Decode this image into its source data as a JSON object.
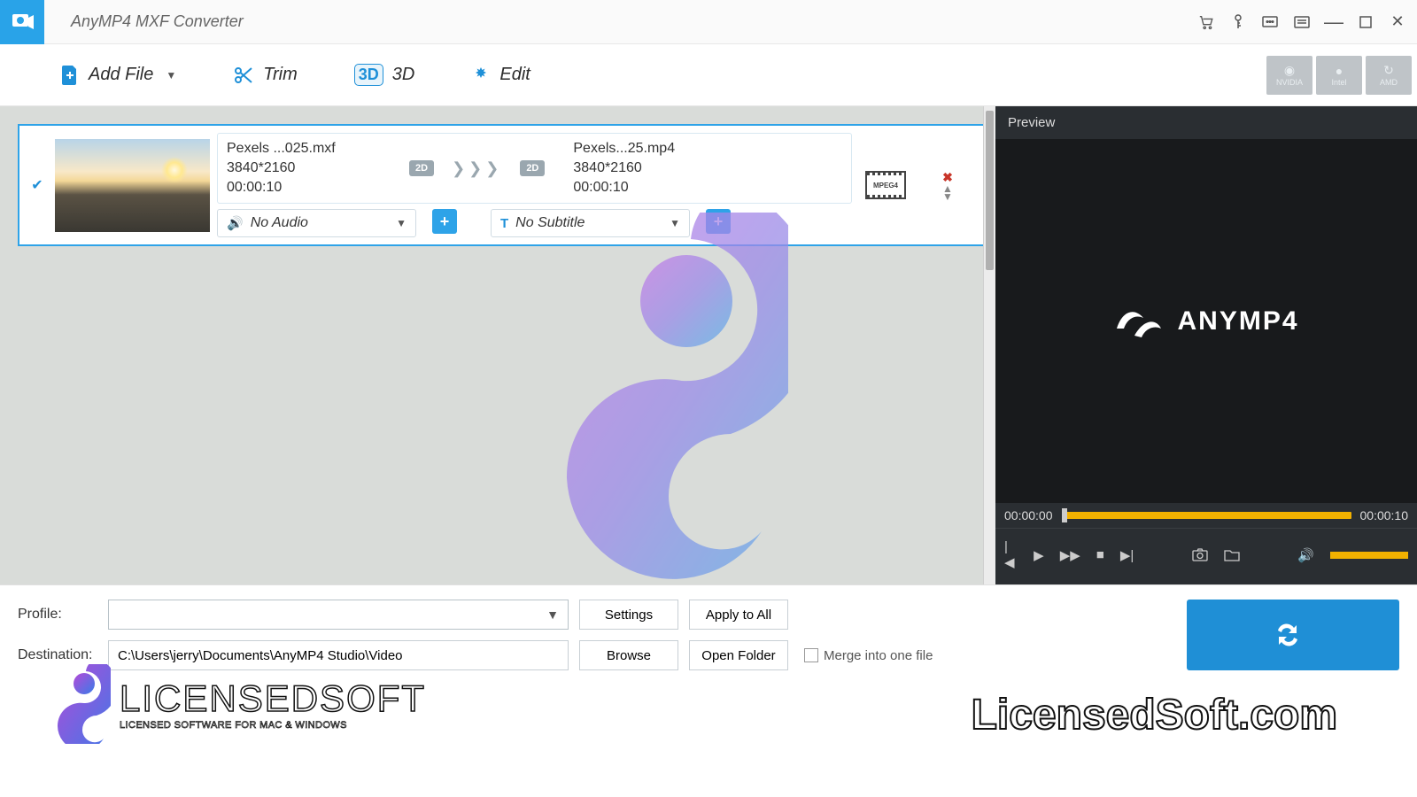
{
  "app": {
    "title": "AnyMP4 MXF Converter"
  },
  "toolbar": {
    "add_file": "Add File",
    "trim": "Trim",
    "three_d": "3D",
    "edit": "Edit"
  },
  "gpu": {
    "nvidia": "NVIDIA",
    "intel": "Intel",
    "amd": "AMD"
  },
  "file": {
    "src_name": "Pexels ...025.mxf",
    "src_res": "3840*2160",
    "src_dur": "00:00:10",
    "src_badge": "2D",
    "dst_name": "Pexels...25.mp4",
    "dst_res": "3840*2160",
    "dst_dur": "00:00:10",
    "dst_badge": "2D",
    "codec": "MPEG4",
    "audio_dd": "No Audio",
    "subtitle_dd": "No Subtitle"
  },
  "preview": {
    "title": "Preview",
    "brand": "ANYMP4",
    "time_start": "00:00:00",
    "time_end": "00:00:10"
  },
  "bottom": {
    "profile_label": "Profile:",
    "dest_label": "Destination:",
    "dest_value": "C:\\Users\\jerry\\Documents\\AnyMP4 Studio\\Video",
    "settings": "Settings",
    "apply_all": "Apply to All",
    "browse": "Browse",
    "open_folder": "Open Folder",
    "merge": "Merge into one file",
    "convert": "Convert"
  },
  "watermark": {
    "brand": "LICENSEDSOFT",
    "tagline": "LICENSED SOFTWARE FOR MAC & WINDOWS",
    "site": "LicensedSoft.com"
  }
}
